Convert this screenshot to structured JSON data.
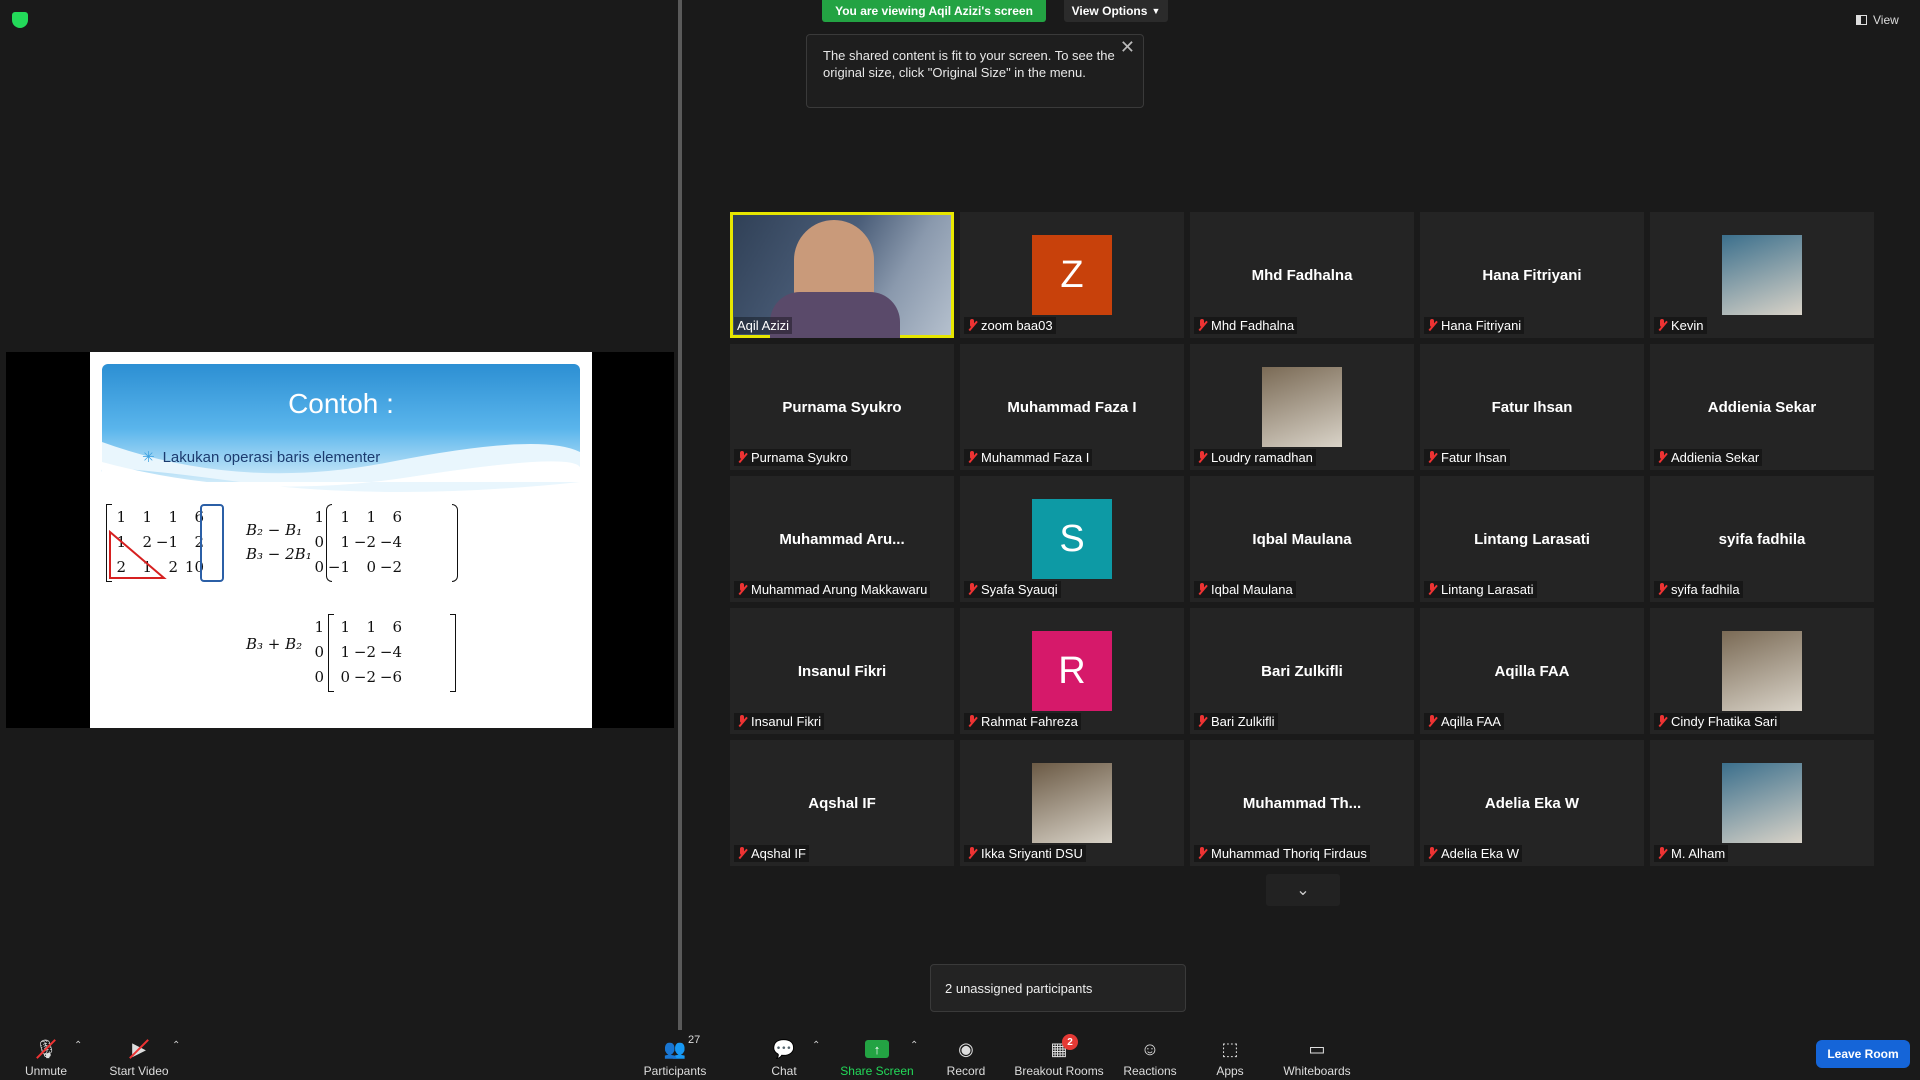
{
  "banner": {
    "viewing_text": "You are viewing Aqil Azizi's screen",
    "view_options": "View Options",
    "view": "View"
  },
  "tooltip": {
    "line1": "The shared content is fit to your screen. To see the",
    "line2": "original size, click \"Original Size\" in the menu."
  },
  "slide": {
    "title": "Contoh :",
    "bullet": "Lakukan operasi baris elementer",
    "matrix1": [
      [
        "1",
        "1",
        "1",
        "6"
      ],
      [
        "1",
        "2",
        "−1",
        "2"
      ],
      [
        "2",
        "1",
        "2",
        "10"
      ]
    ],
    "ops1": [
      "B₂ − B₁",
      "B₃ − 2B₁"
    ],
    "matrix2": [
      [
        "1",
        "1",
        "1",
        "6"
      ],
      [
        "0",
        "1",
        "−2",
        "−4"
      ],
      [
        "0",
        "−1",
        "0",
        "−2"
      ]
    ],
    "ops2": "B₃ + B₂",
    "matrix3": [
      [
        "1",
        "1",
        "1",
        "6"
      ],
      [
        "0",
        "1",
        "−2",
        "−4"
      ],
      [
        "0",
        "0",
        "−2",
        "−6"
      ]
    ]
  },
  "participants_grid": [
    {
      "name": "Aqil Azizi",
      "center": "",
      "type": "video"
    },
    {
      "name": "zoom baa03",
      "center": "Z",
      "type": "avatar",
      "color": "#c8410b"
    },
    {
      "name": "Mhd Fadhalna",
      "center": "Mhd Fadhalna",
      "type": "text"
    },
    {
      "name": "Hana Fitriyani",
      "center": "Hana Fitriyani",
      "type": "text"
    },
    {
      "name": "Kevin",
      "center": "",
      "type": "photo"
    },
    {
      "name": "Purnama Syukro",
      "center": "Purnama Syukro",
      "type": "text"
    },
    {
      "name": "Muhammad Faza I",
      "center": "Muhammad Faza I",
      "type": "text"
    },
    {
      "name": "Loudry ramadhan",
      "center": "",
      "type": "photo"
    },
    {
      "name": "Fatur Ihsan",
      "center": "Fatur Ihsan",
      "type": "text"
    },
    {
      "name": "Addienia Sekar",
      "center": "Addienia Sekar",
      "type": "text"
    },
    {
      "name": "Muhammad Arung Makkawaru",
      "center": "Muhammad  Aru...",
      "type": "text"
    },
    {
      "name": "Syafa Syauqi",
      "center": "S",
      "type": "avatar",
      "color": "#0d9aa5"
    },
    {
      "name": "Iqbal Maulana",
      "center": "Iqbal Maulana",
      "type": "text"
    },
    {
      "name": "Lintang Larasati",
      "center": "Lintang Larasati",
      "type": "text"
    },
    {
      "name": "syifa fadhila",
      "center": "syifa fadhila",
      "type": "text"
    },
    {
      "name": "Insanul Fikri",
      "center": "Insanul Fikri",
      "type": "text"
    },
    {
      "name": "Rahmat Fahreza",
      "center": "R",
      "type": "avatar",
      "color": "#d6196a"
    },
    {
      "name": "Bari Zulkifli",
      "center": "Bari Zulkifli",
      "type": "text"
    },
    {
      "name": "Aqilla FAA",
      "center": "Aqilla FAA",
      "type": "text"
    },
    {
      "name": "Cindy Fhatika Sari",
      "center": "",
      "type": "photo"
    },
    {
      "name": "Aqshal IF",
      "center": "Aqshal IF",
      "type": "text"
    },
    {
      "name": "Ikka Sriyanti DSU",
      "center": "",
      "type": "photo"
    },
    {
      "name": "Muhammad Thoriq Firdaus",
      "center": "Muhammad  Th...",
      "type": "text"
    },
    {
      "name": "Adelia Eka W",
      "center": "Adelia Eka W",
      "type": "text"
    },
    {
      "name": "M. Alham",
      "center": "",
      "type": "photo"
    }
  ],
  "unassigned": "2 unassigned participants",
  "toolbar": {
    "unmute": "Unmute",
    "start_video": "Start Video",
    "participants": "Participants",
    "participants_count": "27",
    "chat": "Chat",
    "share_screen": "Share Screen",
    "record": "Record",
    "breakout_rooms": "Breakout Rooms",
    "breakout_badge": "2",
    "reactions": "Reactions",
    "apps": "Apps",
    "whiteboards": "Whiteboards",
    "leave_room": "Leave Room"
  },
  "colors": {
    "share_green": "#23a343",
    "leave_blue": "#1565d8",
    "active_speaker": "#e6e600"
  }
}
